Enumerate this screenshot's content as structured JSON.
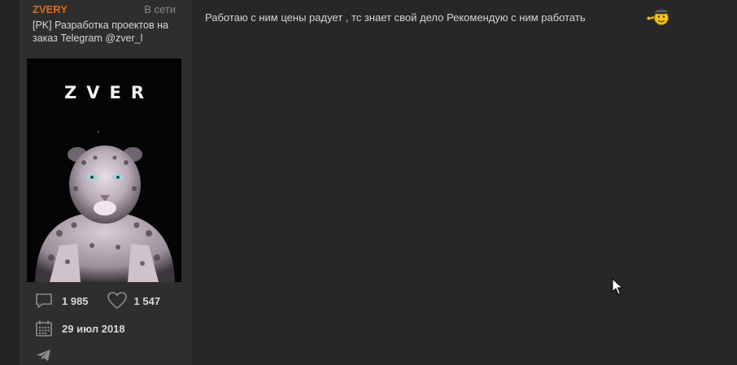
{
  "user": {
    "name": "ZVERY",
    "status": "В сети",
    "title": "[PK] Разработка проектов на заказ Telegram @zver_l",
    "avatar_text": "ZVER"
  },
  "stats": {
    "messages": "1 985",
    "likes": "1 547",
    "registered": "29 июл 2018"
  },
  "icons": {
    "messages": "speech-bubble-icon",
    "likes": "heart-icon",
    "registered": "calendar-icon",
    "telegram": "telegram-icon",
    "emoji": "smiley-with-hat-icon"
  },
  "post": {
    "text": "Работаю с ним цены радует , тс знает свой дело Рекомендую с ним работать"
  },
  "colors": {
    "username": "#df6b1d",
    "background": "#272727",
    "sidebar": "#2e2e2e",
    "text": "#d6d6d6"
  }
}
